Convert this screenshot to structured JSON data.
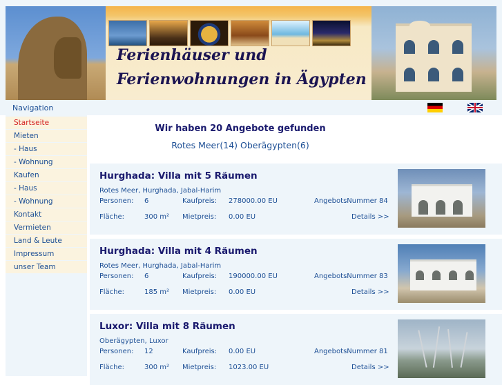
{
  "header": {
    "title_line1": "Ferienhäuser und",
    "title_line2": "Ferienwohnungen in Ägypten"
  },
  "navbar": {
    "label": "Navigation",
    "languages": [
      "de-flag-icon",
      "uk-flag-icon"
    ]
  },
  "sidebar": {
    "items": [
      {
        "label": "Startseite",
        "active": true
      },
      {
        "label": "Mieten"
      },
      {
        "label": "- Haus"
      },
      {
        "label": "- Wohnung"
      },
      {
        "label": "Kaufen"
      },
      {
        "label": "- Haus"
      },
      {
        "label": "- Wohnung"
      },
      {
        "label": "Kontakt"
      },
      {
        "label": "Vermieten"
      },
      {
        "label": "Land & Leute"
      },
      {
        "label": "Impressum"
      },
      {
        "label": "unser Team"
      }
    ]
  },
  "results": {
    "heading": "Wir haben 20 Angebote gefunden",
    "regions": "Rotes Meer(14) Oberägypten(6)"
  },
  "labels": {
    "persons": "Personen:",
    "area": "Fläche:",
    "purchase_price": "Kaufpreis:",
    "rent_price": "Mietpreis:",
    "details": "Details >>"
  },
  "listings": [
    {
      "title": "Hurghada: Villa mit 5 Räumen",
      "location": "Rotes Meer, Hurghada, Jabal-Harim",
      "persons": "6",
      "area": "300 m²",
      "purchase_price": "278000.00 EU",
      "rent_price": "0.00 EU",
      "offer_number": "AngebotsNummer 84"
    },
    {
      "title": "Hurghada: Villa mit 4 Räumen",
      "location": "Rotes Meer, Hurghada, Jabal-Harim",
      "persons": "6",
      "area": "185 m²",
      "purchase_price": "190000.00 EU",
      "rent_price": "0.00 EU",
      "offer_number": "AngebotsNummer 83"
    },
    {
      "title": "Luxor: Villa mit 8 Räumen",
      "location": "Oberägypten, Luxor",
      "persons": "12",
      "area": "300 m²",
      "purchase_price": "0.00 EU",
      "rent_price": "1023.00 EU",
      "offer_number": "AngebotsNummer 81"
    }
  ]
}
